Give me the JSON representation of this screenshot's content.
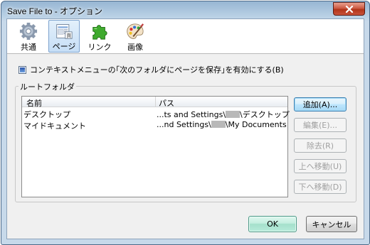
{
  "window": {
    "title": "Save File to - オプション"
  },
  "toolbar": {
    "items": [
      {
        "label": "共通",
        "icon": "gear-icon"
      },
      {
        "label": "ページ",
        "icon": "page-icon"
      },
      {
        "label": "リンク",
        "icon": "puzzle-icon"
      },
      {
        "label": "画像",
        "icon": "palette-icon"
      }
    ],
    "selected": "ページ"
  },
  "options": {
    "context_menu_checkbox_label": "コンテキストメニューの｢次のフォルダにページを保存｣を有効にする(B)",
    "context_menu_checked": true
  },
  "root_folders": {
    "group_label": "ルートフォルダ",
    "columns": [
      "名前",
      "パス"
    ],
    "rows": [
      {
        "name": "デスクトップ",
        "path_prefix": "...ts and Settings\\",
        "path_suffix": "\\デスクトップ"
      },
      {
        "name": "マイドキュメント",
        "path_prefix": "...nd Settings\\",
        "path_suffix": "\\My Documents"
      }
    ]
  },
  "buttons": {
    "add": "追加(A)...",
    "edit": "編集(E)...",
    "remove": "除去(R)",
    "move_up": "上へ移動(U)",
    "move_down": "下へ移動(D)",
    "ok": "OK",
    "cancel": "キャンセル"
  },
  "colors": {
    "titlebar": "#b7cfe4",
    "close_button": "#c9523a",
    "selected_tab": "#c6def6",
    "ok_button": "#a4e0cb"
  }
}
